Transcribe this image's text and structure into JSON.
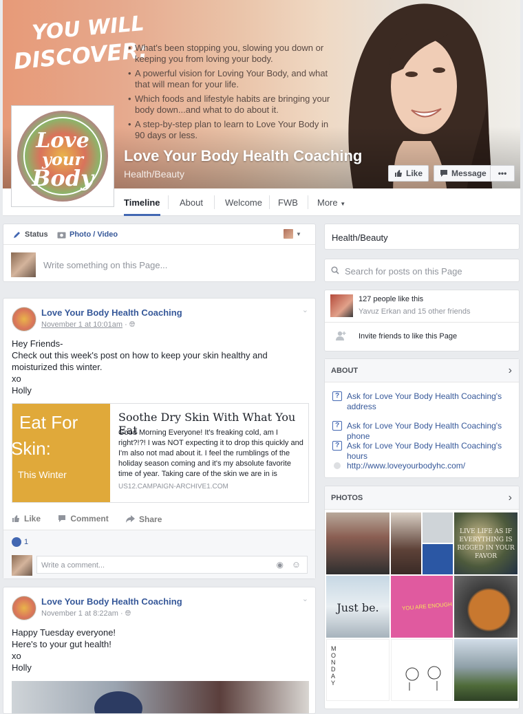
{
  "cover": {
    "headline_line1": "YOU WILL",
    "headline_line2": "DISCOVER:",
    "bullets": [
      "What's been stopping you, slowing you down or keeping you from loving your body.",
      "A powerful vision for Loving Your Body, and what that will mean for your life.",
      "Which foods and lifestyle habits are bringing your body down...and what to do about it.",
      "A step-by-step plan to learn to Love Your Body in 90 days or less."
    ],
    "page_name": "Love Your Body Health Coaching",
    "category": "Health/Beauty",
    "like_button": "Like",
    "message_button": "Message",
    "more_button": "•••"
  },
  "profile": {
    "logo_line1": "Love",
    "logo_line2": "your",
    "logo_line3": "Body"
  },
  "tabs": [
    "Timeline",
    "About",
    "Welcome",
    "FWB",
    "More"
  ],
  "composer": {
    "status_tab": "Status",
    "photo_tab": "Photo / Video",
    "placeholder": "Write something on this Page..."
  },
  "posts": [
    {
      "author": "Love Your Body Health Coaching",
      "time": "November 1 at 10:01am",
      "body": [
        "Hey Friends-",
        "Check out this week's post on how to keep your skin healthy and moisturized this winter.",
        "xo",
        "Holly"
      ],
      "attachment": {
        "image_line1": "Eat For",
        "image_line2": "Skin:",
        "image_line3": "This Winter",
        "title": "Soothe Dry Skin With What You Eat",
        "description": "Good Morning Everyone! It's freaking cold, am I right?!?! I was NOT expecting it to drop this quickly and I'm also not mad about it. I feel the rumblings of the holiday season coming and it's my absolute favorite time of year.  Taking care of the skin we are in is",
        "domain": "US12.CAMPAIGN-ARCHIVE1.COM"
      },
      "actions": {
        "like": "Like",
        "comment": "Comment",
        "share": "Share"
      },
      "like_count": "1",
      "comment_placeholder": "Write a comment..."
    },
    {
      "author": "Love Your Body Health Coaching",
      "time": "November 1 at 8:22am",
      "body": [
        "Happy Tuesday everyone!",
        "Here's to your gut health!",
        "xo",
        "Holly"
      ]
    }
  ],
  "sidebar": {
    "category": "Health/Beauty",
    "search_placeholder": "Search for posts on this Page",
    "likes": "127 people like this",
    "friends": "Yavuz Erkan and 15 other friends",
    "invite": "Invite friends to like this Page",
    "about_header": "ABOUT",
    "about_items": [
      "Ask for Love Your Body Health Coaching's address",
      "Ask for Love Your Body Health Coaching's phone",
      "Ask for Love Your Body Health Coaching's hours"
    ],
    "website": "http://www.loveyourbodyhc.com/",
    "photos_header": "PHOTOS",
    "photo_texts": {
      "live_life": "LIVE LIFE AS IF EVERYTHING IS RIGGED IN YOUR FAVOR",
      "just_be": "Just be.",
      "you_are_enough": "YOU ARE ENOUGH",
      "monday": "MONDAY"
    }
  },
  "colors": {
    "brand_blue": "#4267b2",
    "link": "#365899",
    "background": "#e9ebee"
  }
}
